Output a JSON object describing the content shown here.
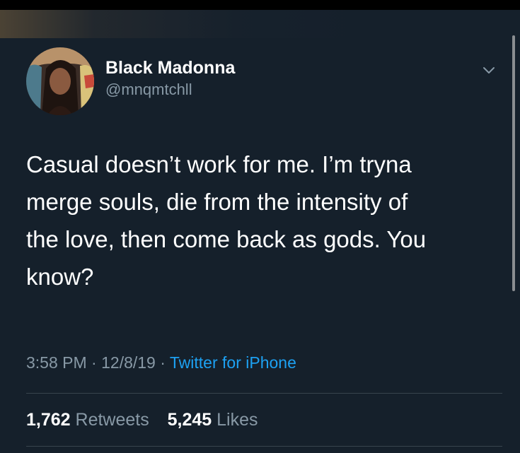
{
  "tweet": {
    "author": {
      "name": "Black Madonna",
      "handle": "@mnqmtchll"
    },
    "text_lines": [
      "Casual doesn’t work for me. I’m tryna",
      "merge souls, die from the intensity of",
      "the love, then come back as gods. You",
      "know?"
    ],
    "meta": {
      "time": "3:58 PM",
      "separator": "·",
      "date": "12/8/19",
      "source": "Twitter for iPhone"
    },
    "stats": {
      "retweets_count": "1,762",
      "retweets_label": "Retweets",
      "likes_count": "5,245",
      "likes_label": "Likes"
    }
  },
  "icons": {
    "menu": "chevron-down-icon"
  },
  "colors": {
    "background": "#15202b",
    "primary_text": "#ffffff",
    "secondary_text": "#8899a6",
    "link": "#1da1f2",
    "divider": "#38444d"
  }
}
